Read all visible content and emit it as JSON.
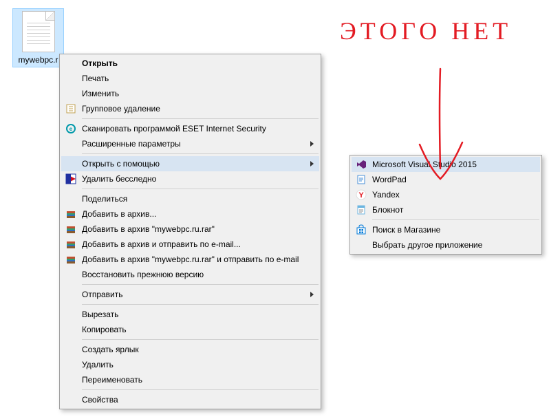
{
  "file": {
    "name": "mywebpc.r"
  },
  "menu": {
    "open": "Открыть",
    "print": "Печать",
    "edit": "Изменить",
    "group_delete": "Групповое удаление",
    "eset_scan": "Сканировать программой ESET Internet Security",
    "advanced_options": "Расширенные параметры",
    "open_with": "Открыть с помощью",
    "shred": "Удалить бесследно",
    "share": "Поделиться",
    "add_to_archive": "Добавить в архив...",
    "add_to_archive_named": "Добавить в архив \"mywebpc.ru.rar\"",
    "add_archive_email": "Добавить в архив и отправить по e-mail...",
    "add_archive_named_email": "Добавить в архив \"mywebpc.ru.rar\" и отправить по e-mail",
    "restore_previous": "Восстановить прежнюю версию",
    "send_to": "Отправить",
    "cut": "Вырезать",
    "copy": "Копировать",
    "create_shortcut": "Создать ярлык",
    "delete": "Удалить",
    "rename": "Переименовать",
    "properties": "Свойства"
  },
  "submenu": {
    "vs": "Microsoft Visual Studio 2015",
    "wordpad": "WordPad",
    "yandex": "Yandex",
    "notepad": "Блокнот",
    "store": "Поиск в Магазине",
    "choose_other": "Выбрать другое приложение"
  },
  "annotation": {
    "text": "ЭТОГО НЕТ"
  }
}
